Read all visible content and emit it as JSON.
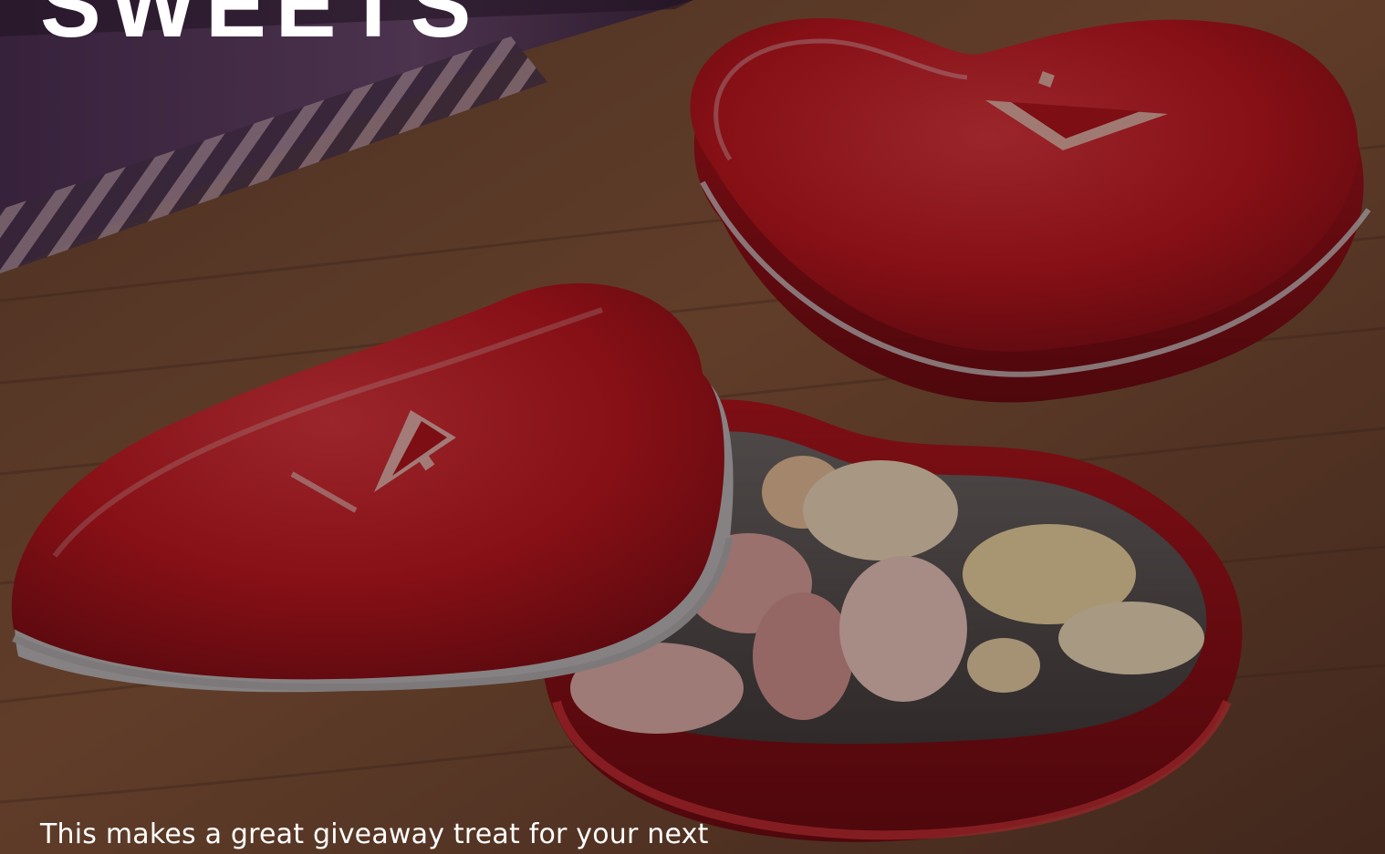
{
  "hero": {
    "title": "SWEETS",
    "description": "This makes a great giveaway treat for your next"
  },
  "image": {
    "icon": "product-photo-heart-tins",
    "colors": {
      "tin_red": "#c3141c",
      "tin_dark": "#7a0a10",
      "wood": "#8a5a3a",
      "book_purple": "#5b3b63",
      "candy_pink": "#e8b8b0",
      "candy_yellow": "#f3dcae",
      "text": "#ffffff"
    }
  }
}
